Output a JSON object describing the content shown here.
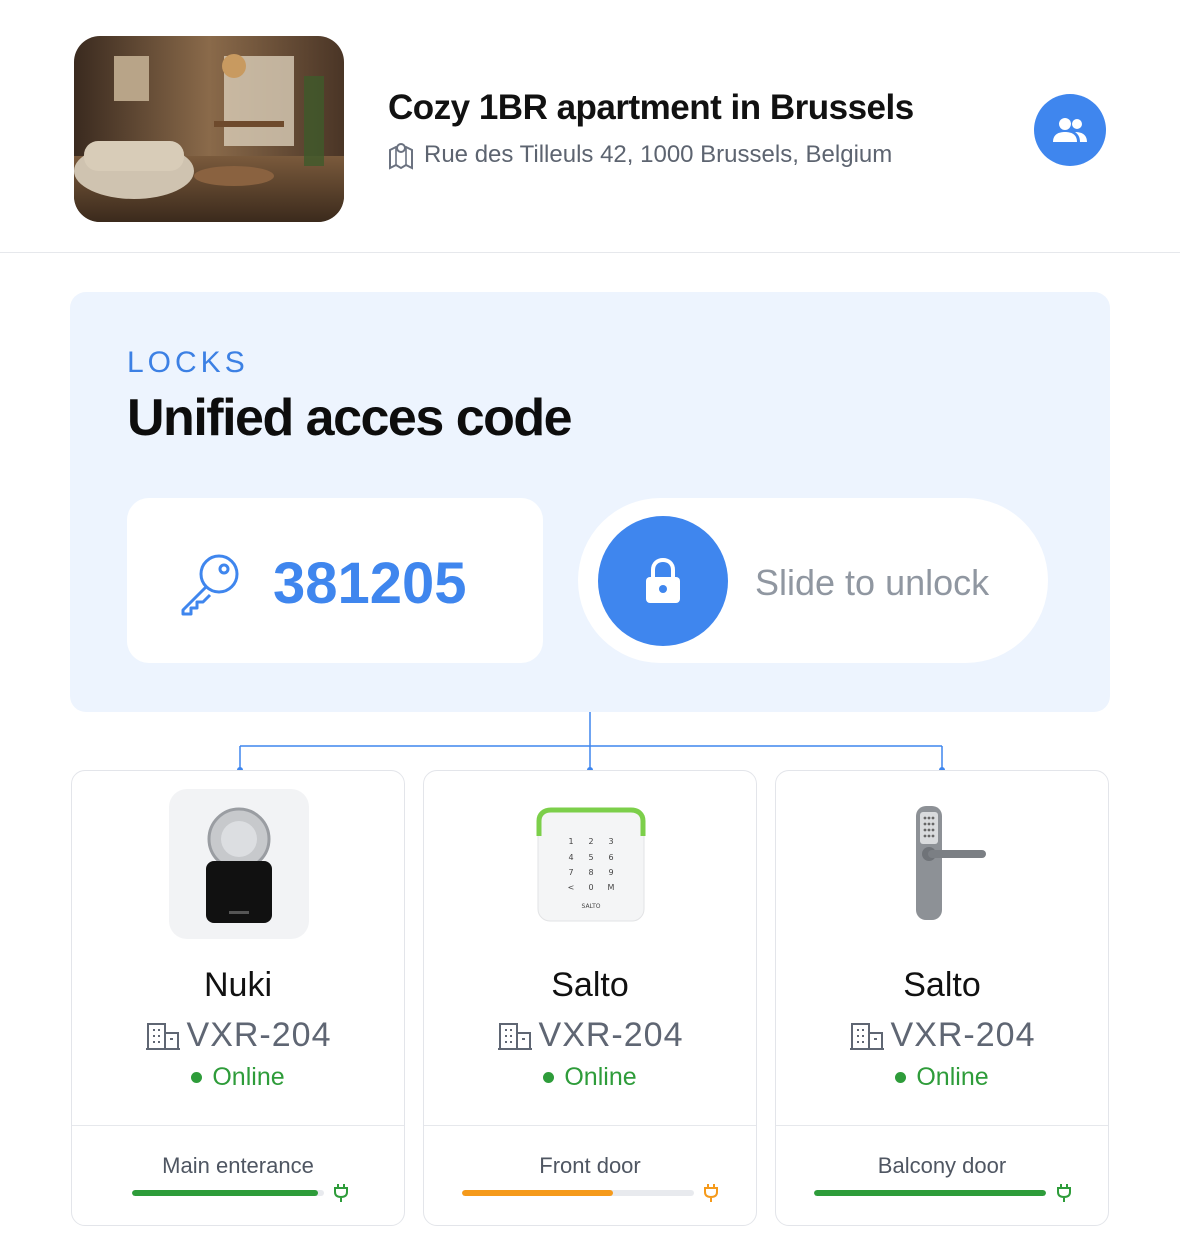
{
  "listing": {
    "title": "Cozy 1BR apartment in Brussels",
    "address": "Rue des Tilleuls 42, 1000 Brussels, Belgium",
    "thumbnail_icon": "living-room-photo"
  },
  "header": {
    "team_button_icon": "people-icon"
  },
  "locks": {
    "eyebrow": "LOCKS",
    "title": "Unified acces code",
    "code": "381205",
    "slide_label": "Slide to unlock"
  },
  "devices": [
    {
      "brand": "Nuki",
      "unit": "VXR-204",
      "status": "Online",
      "door": "Main enterance",
      "battery": 0.97,
      "battery_color": "#2e9c3a"
    },
    {
      "brand": "Salto",
      "unit": "VXR-204",
      "status": "Online",
      "door": "Front door",
      "battery": 0.65,
      "battery_color": "#f59a1b"
    },
    {
      "brand": "Salto",
      "unit": "VXR-204",
      "status": "Online",
      "door": "Balcony door",
      "battery": 1.0,
      "battery_color": "#2e9c3a"
    }
  ],
  "colors": {
    "accent": "#3f86ee",
    "online": "#2e9c3a",
    "warning": "#f59a1b",
    "panel_bg": "#edf4fe"
  }
}
